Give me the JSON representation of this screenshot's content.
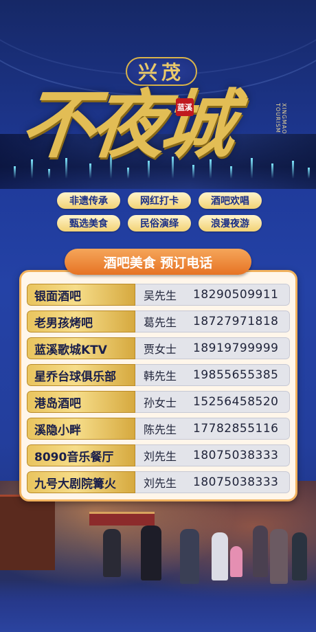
{
  "header": {
    "badge": "兴茂",
    "main_title": "不夜城",
    "seal": "蓝溪",
    "vertical_text": "XINGMAO TOURISM"
  },
  "tags": [
    "非遗传承",
    "网红打卡",
    "酒吧欢唱",
    "甄选美食",
    "民俗演绎",
    "浪漫夜游"
  ],
  "ribbon": "酒吧美食  预订电话",
  "venues": [
    {
      "venue": "银面酒吧",
      "name": "吴先生",
      "phone": "18290509911"
    },
    {
      "venue": "老男孩烤吧",
      "name": "葛先生",
      "phone": "18727971818"
    },
    {
      "venue": "蓝溪歌城KTV",
      "name": "贾女士",
      "phone": "18919799999"
    },
    {
      "venue": "星乔台球俱乐部",
      "name": "韩先生",
      "phone": "19855655385"
    },
    {
      "venue": "港岛酒吧",
      "name": "孙女士",
      "phone": "15256458520"
    },
    {
      "venue": "溪隐小畔",
      "name": "陈先生",
      "phone": "17782855116"
    },
    {
      "venue": "8090音乐餐厅",
      "name": "刘先生",
      "phone": "18075038333"
    },
    {
      "venue": "九号大剧院篝火",
      "name": "刘先生",
      "phone": "18075038333"
    }
  ],
  "colors": {
    "background": "#1f3a9a",
    "gold": "#e2bd55",
    "ribbon": "#e67324",
    "card": "#fff6ea"
  }
}
